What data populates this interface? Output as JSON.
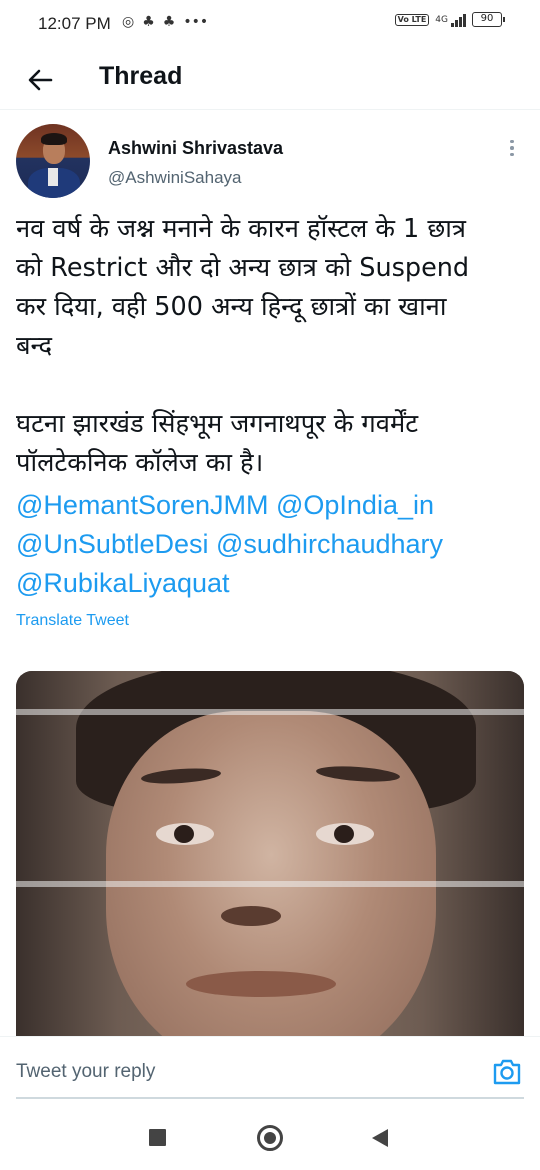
{
  "status_bar": {
    "time": "12:07 PM",
    "network": "4G",
    "battery": "90",
    "volte_label": "Vo LTE"
  },
  "header": {
    "title": "Thread",
    "back_icon": "arrow-left-icon"
  },
  "tweet": {
    "author": {
      "name": "Ashwini Shrivastava",
      "handle": "@AshwiniSahaya"
    },
    "text_lines": [
      "नव वर्ष के जश्न मनाने के कारन हॉस्टल के 1 छात्र",
      "को Restrict और दो अन्य छात्र को Suspend",
      "कर दिया, वही 500 अन्य हिन्दू छात्रों का खाना",
      "बन्द",
      "",
      "घटना झारखंड सिंहभूम जगनाथपूर के गवर्मेंट",
      "पॉलटेकनिक कॉलेज का है।"
    ],
    "mentions_lines": [
      "@HemantSorenJMM @OpIndia_in",
      "@UnSubtleDesi @sudhirchaudhary",
      "@RubikaLiyaquat"
    ],
    "translate_label": "Translate Tweet"
  },
  "reply": {
    "placeholder": "Tweet your reply",
    "camera_icon": "camera-icon"
  },
  "colors": {
    "accent": "#1d9bf0",
    "text": "#0f1419",
    "secondary": "#536471"
  }
}
